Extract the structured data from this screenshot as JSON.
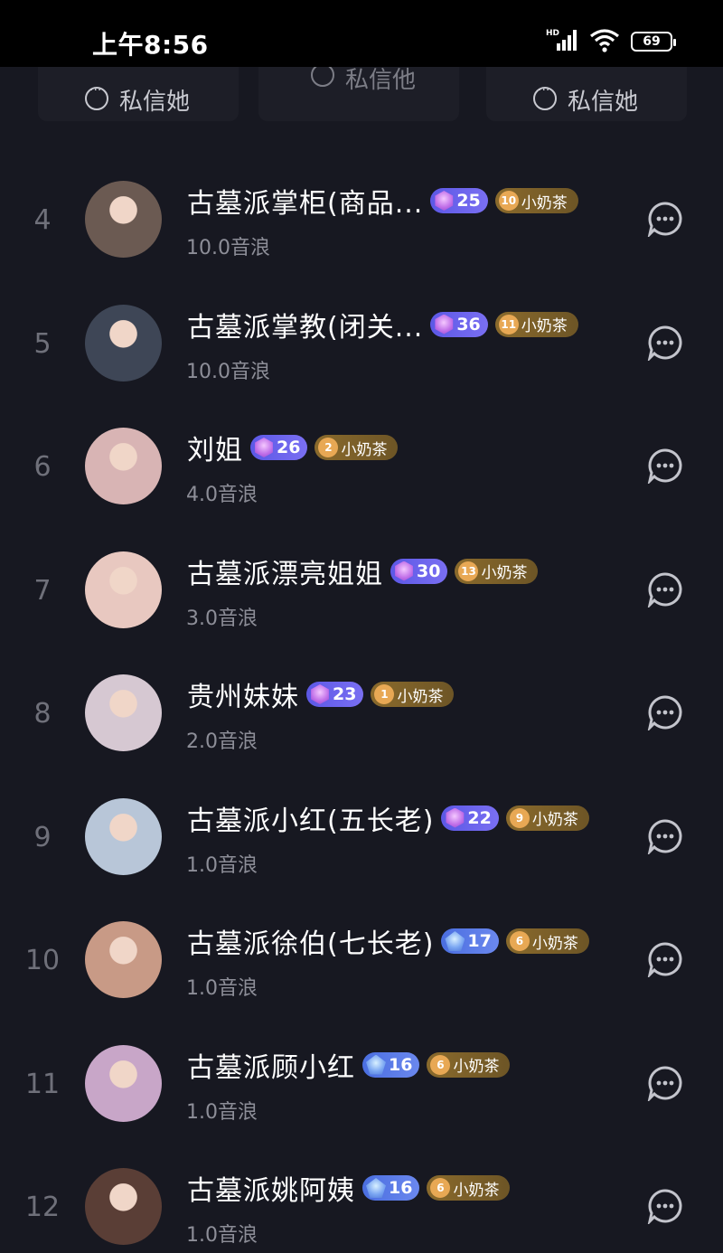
{
  "status_bar": {
    "time": "上午8:56",
    "network": "HD",
    "battery": "69"
  },
  "top_dm_buttons": [
    {
      "label": "私信她"
    },
    {
      "label": "私信他"
    },
    {
      "label": "私信她"
    }
  ],
  "list": [
    {
      "rank": "4",
      "name": "古墓派掌柜(商品...",
      "level": "25",
      "level_style": "purple",
      "fan_level": "10",
      "fan_label": "小奶茶",
      "score": "10.0音浪",
      "avatar_color": "#6b5a52"
    },
    {
      "rank": "5",
      "name": "古墓派掌教(闭关...",
      "level": "36",
      "level_style": "purple",
      "fan_level": "11",
      "fan_label": "小奶茶",
      "score": "10.0音浪",
      "avatar_color": "#3e4656"
    },
    {
      "rank": "6",
      "name": "刘姐",
      "level": "26",
      "level_style": "purple",
      "fan_level": "2",
      "fan_label": "小奶茶",
      "score": "4.0音浪",
      "avatar_color": "#d8b4b4"
    },
    {
      "rank": "7",
      "name": "古墓派漂亮姐姐",
      "level": "30",
      "level_style": "purple",
      "fan_level": "13",
      "fan_label": "小奶茶",
      "score": "3.0音浪",
      "avatar_color": "#e8c8c0"
    },
    {
      "rank": "8",
      "name": "贵州妹妹",
      "level": "23",
      "level_style": "purple",
      "fan_level": "1",
      "fan_label": "小奶茶",
      "score": "2.0音浪",
      "avatar_color": "#d6c8d2"
    },
    {
      "rank": "9",
      "name": "古墓派小红(五长老)",
      "level": "22",
      "level_style": "purple",
      "fan_level": "9",
      "fan_label": "小奶茶",
      "score": "1.0音浪",
      "avatar_color": "#b8c6d8"
    },
    {
      "rank": "10",
      "name": "古墓派徐伯(七长老)",
      "level": "17",
      "level_style": "blue",
      "fan_level": "6",
      "fan_label": "小奶茶",
      "score": "1.0音浪",
      "avatar_color": "#c89a86"
    },
    {
      "rank": "11",
      "name": "古墓派顾小红",
      "level": "16",
      "level_style": "blue",
      "fan_level": "6",
      "fan_label": "小奶茶",
      "score": "1.0音浪",
      "avatar_color": "#c8a6c8"
    },
    {
      "rank": "12",
      "name": "古墓派姚阿姨",
      "level": "16",
      "level_style": "blue",
      "fan_level": "6",
      "fan_label": "小奶茶",
      "score": "1.0音浪",
      "avatar_color": "#5a3e36"
    }
  ]
}
